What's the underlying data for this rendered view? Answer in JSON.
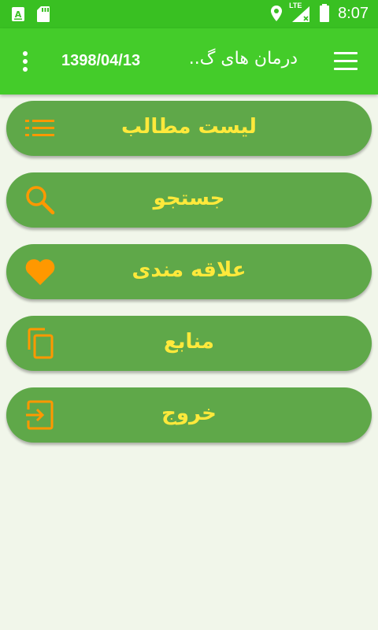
{
  "status_bar": {
    "time": "8:07",
    "network": "LTE",
    "icons": [
      "keyboard-a-icon",
      "sd-card-icon",
      "location-icon",
      "signal-icon",
      "battery-icon"
    ]
  },
  "app_bar": {
    "title": "درمان های گ..",
    "date": "1398/04/13",
    "menu_icon": "hamburger-icon",
    "overflow_icon": "overflow-vertical-icon",
    "background": "#44cc2a"
  },
  "menu": {
    "items": [
      {
        "label": "لیست مطالب",
        "icon": "list-icon"
      },
      {
        "label": "جستجو",
        "icon": "search-icon"
      },
      {
        "label": "علاقه مندی",
        "icon": "heart-icon"
      },
      {
        "label": "منابع",
        "icon": "copy-icon"
      },
      {
        "label": "خروج",
        "icon": "exit-icon"
      }
    ],
    "card_color": "#5fa849",
    "label_color": "#ffe93b",
    "icon_color": "#ff9800"
  }
}
